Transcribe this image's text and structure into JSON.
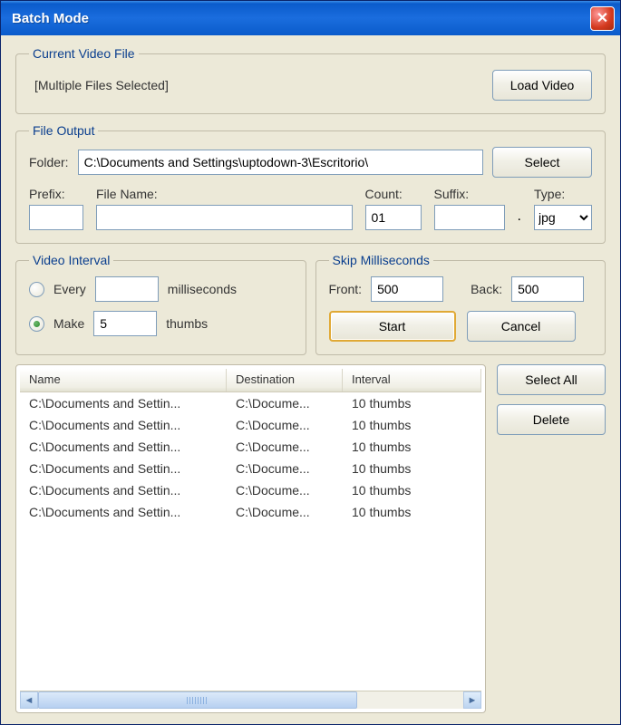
{
  "window": {
    "title": "Batch Mode"
  },
  "current_video": {
    "legend": "Current Video File",
    "status": "[Multiple Files Selected]",
    "load_button": "Load Video"
  },
  "file_output": {
    "legend": "File Output",
    "folder_label": "Folder:",
    "folder_value": "C:\\Documents and Settings\\uptodown-3\\Escritorio\\",
    "select_button": "Select",
    "prefix_label": "Prefix:",
    "prefix_value": "",
    "filename_label": "File Name:",
    "filename_value": "",
    "count_label": "Count:",
    "count_value": "01",
    "suffix_label": "Suffix:",
    "suffix_value": "",
    "type_label": "Type:",
    "type_value": "jpg"
  },
  "video_interval": {
    "legend": "Video Interval",
    "every_label": "Every",
    "every_value": "",
    "every_unit": "milliseconds",
    "make_label": "Make",
    "make_value": "5",
    "make_unit": "thumbs",
    "selected": "make"
  },
  "skip_ms": {
    "legend": "Skip Milliseconds",
    "front_label": "Front:",
    "front_value": "500",
    "back_label": "Back:",
    "back_value": "500"
  },
  "actions": {
    "start": "Start",
    "cancel": "Cancel"
  },
  "list": {
    "columns": {
      "name": "Name",
      "dest": "Destination",
      "interval": "Interval"
    },
    "rows": [
      {
        "name": "C:\\Documents and Settin...",
        "dest": "C:\\Docume...",
        "interval": "10 thumbs"
      },
      {
        "name": "C:\\Documents and Settin...",
        "dest": "C:\\Docume...",
        "interval": "10 thumbs"
      },
      {
        "name": "C:\\Documents and Settin...",
        "dest": "C:\\Docume...",
        "interval": "10 thumbs"
      },
      {
        "name": "C:\\Documents and Settin...",
        "dest": "C:\\Docume...",
        "interval": "10 thumbs"
      },
      {
        "name": "C:\\Documents and Settin...",
        "dest": "C:\\Docume...",
        "interval": "10 thumbs"
      },
      {
        "name": "C:\\Documents and Settin...",
        "dest": "C:\\Docume...",
        "interval": "10 thumbs"
      }
    ]
  },
  "list_actions": {
    "select_all": "Select All",
    "delete": "Delete"
  }
}
